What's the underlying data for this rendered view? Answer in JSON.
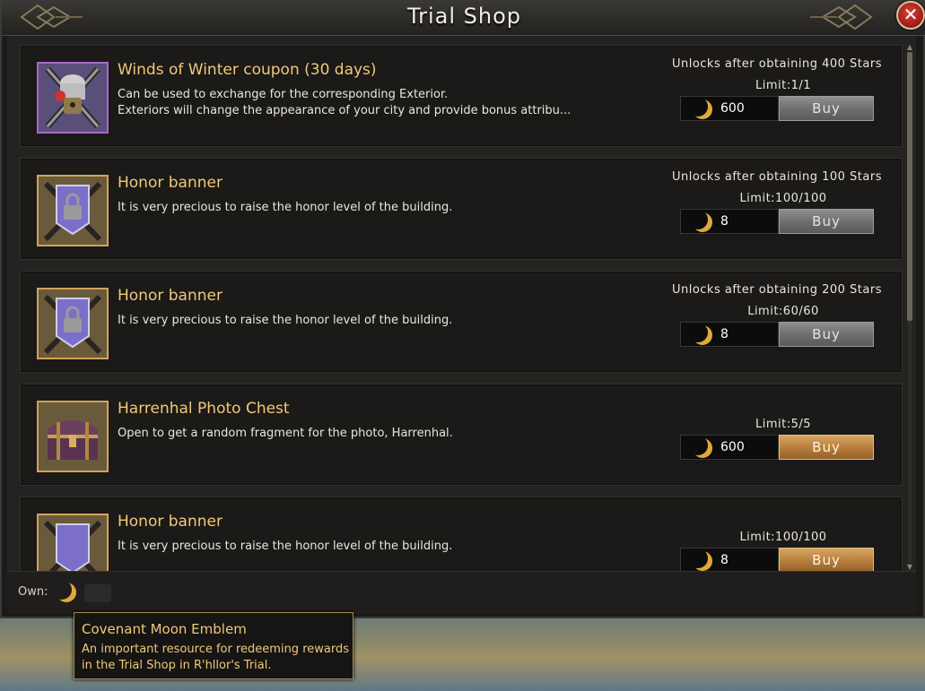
{
  "window": {
    "title": "Trial Shop"
  },
  "items": [
    {
      "name": "Winds of Winter coupon (30 days)",
      "desc_lines": [
        "Can be used to exchange for the corresponding Exterior.",
        "Exteriors will change the appearance of your city and provide bonus attribu..."
      ],
      "unlock": "Unlocks after obtaining 400 Stars",
      "limit": "Limit:1/1",
      "price": "600",
      "buy_label": "Buy",
      "buy_enabled": false,
      "icon": "winter-coupon-icon"
    },
    {
      "name": "Honor banner",
      "desc_lines": [
        "It is very precious to raise the honor level of the building."
      ],
      "unlock": "Unlocks after obtaining 100 Stars",
      "limit": "Limit:100/100",
      "price": "8",
      "buy_label": "Buy",
      "buy_enabled": false,
      "icon": "locked-honor-banner-icon"
    },
    {
      "name": "Honor banner",
      "desc_lines": [
        "It is very precious to raise the honor level of the building."
      ],
      "unlock": "Unlocks after obtaining 200 Stars",
      "limit": "Limit:60/60",
      "price": "8",
      "buy_label": "Buy",
      "buy_enabled": false,
      "icon": "locked-honor-banner-icon"
    },
    {
      "name": "Harrenhal Photo Chest",
      "desc_lines": [
        "Open to get a random fragment for the photo, Harrenhal."
      ],
      "unlock": "",
      "limit": "Limit:5/5",
      "price": "600",
      "buy_label": "Buy",
      "buy_enabled": true,
      "icon": "treasure-chest-icon"
    },
    {
      "name": "Honor banner",
      "desc_lines": [
        "It is very precious to raise the honor level of the building."
      ],
      "unlock": "",
      "limit": "Limit:100/100",
      "price": "8",
      "buy_label": "Buy",
      "buy_enabled": true,
      "icon": "honor-banner-icon"
    }
  ],
  "footer": {
    "own_label": "Own:",
    "currency_icon": "crescent-moon-icon"
  },
  "tooltip": {
    "title": "Covenant Moon Emblem",
    "desc": "An important resource for redeeming rewards in the Trial Shop in R'hllor's Trial."
  },
  "colors": {
    "accent_gold": "#f0c97a",
    "buy_active": "#b57d3a",
    "buy_disabled": "#6f6f6f",
    "close_red": "#a5201b"
  }
}
